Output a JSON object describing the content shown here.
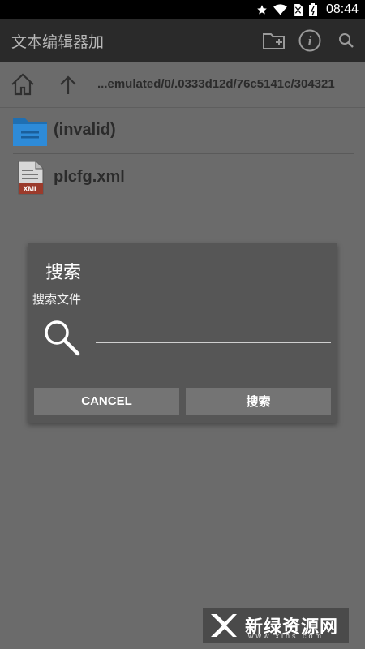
{
  "status_bar": {
    "time": "08:44"
  },
  "app_bar": {
    "title": "文本编辑器加",
    "icons": [
      "new-folder-icon",
      "info-icon",
      "search-icon"
    ]
  },
  "path_bar": {
    "path": "...emulated/0/.0333d12d/76c5141c/304321"
  },
  "files": [
    {
      "name": "(invalid)",
      "icon": "folder-icon"
    },
    {
      "name": "plcfg.xml",
      "icon": "xml-file-icon",
      "icon_label": "XML"
    }
  ],
  "dialog": {
    "title": "搜索",
    "label": "搜索文件",
    "input_value": "",
    "cancel_label": "CANCEL",
    "search_label": "搜索"
  },
  "watermark": {
    "text": "新绿资源网",
    "sub": "www.xlhs.com"
  },
  "colors": {
    "folder_blue": "#2e8bd8",
    "xml_red": "#9b3b2c",
    "dialog_bg": "#565656",
    "button_bg": "#747474"
  }
}
